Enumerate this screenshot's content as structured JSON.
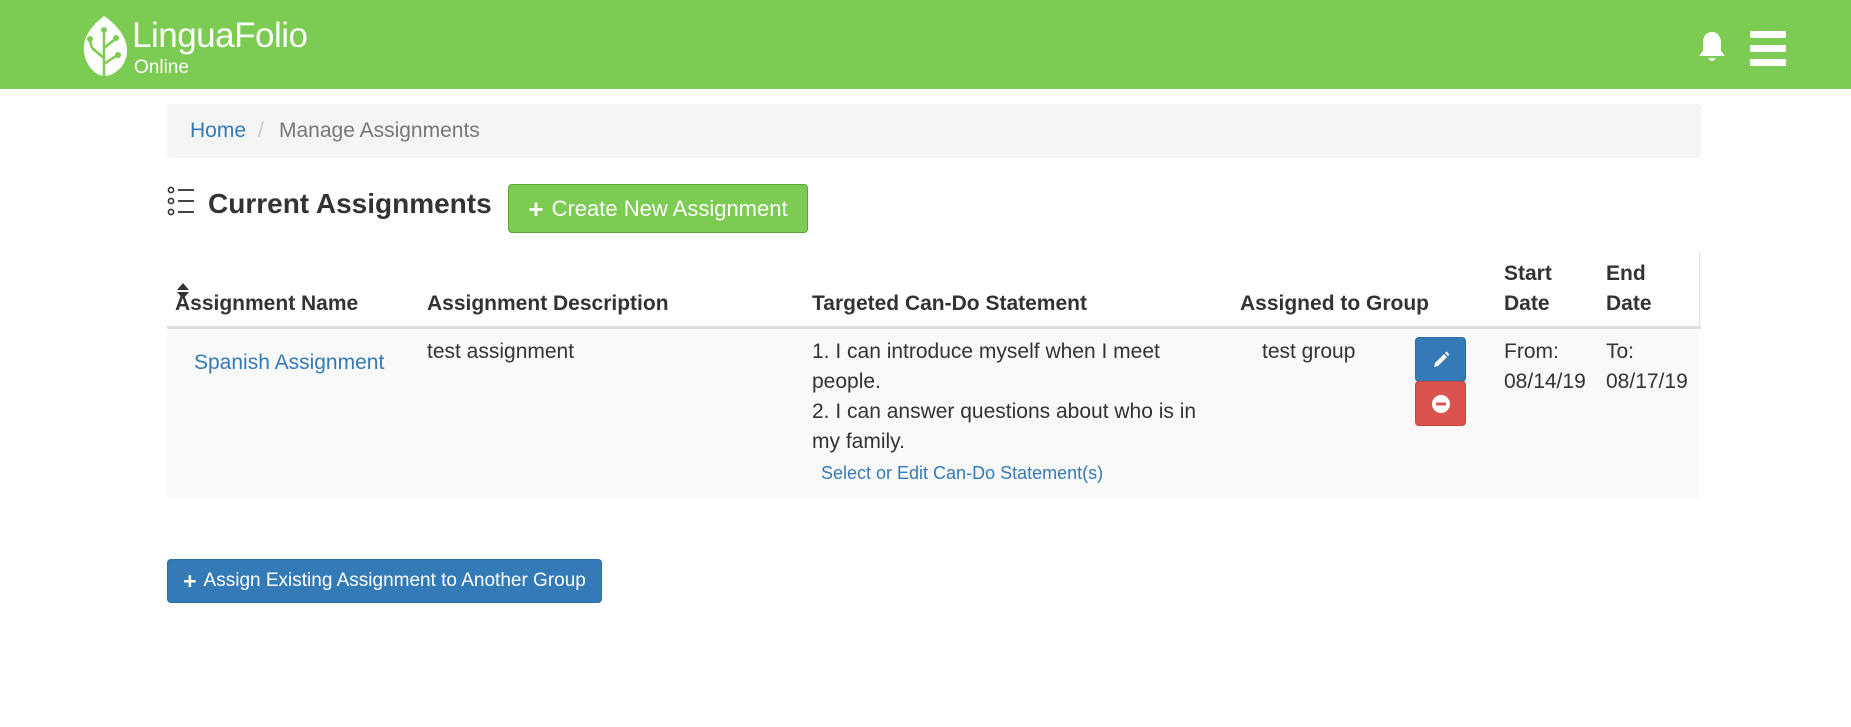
{
  "header": {
    "brand_name": "LinguaFolio",
    "brand_sub": "Online",
    "accent_color": "#7ccb52",
    "icons": [
      "leaf-logo",
      "bell-icon",
      "hamburger-menu-icon"
    ]
  },
  "breadcrumb": {
    "home": "Home",
    "separator": "/",
    "current": "Manage Assignments"
  },
  "main": {
    "title": "Current Assignments",
    "create_button": "Create New Assignment",
    "assign_button": "Assign Existing Assignment to Another Group"
  },
  "table": {
    "headers": {
      "name": "Assignment Name",
      "description": "Assignment Description",
      "cando": "Targeted Can-Do Statement",
      "group": "Assigned to Group",
      "start_1": "Start",
      "start_2": "Date",
      "end_1": "End",
      "end_2": "Date"
    },
    "rows": [
      {
        "name": "Spanish Assignment",
        "description": "test assignment",
        "cando_1a": "1. I can introduce myself when I meet",
        "cando_1b": "people.",
        "cando_2a": "2. I can answer questions about who is in",
        "cando_2b": "my family.",
        "cando_link": "Select or Edit Can-Do Statement(s)",
        "group": "test group",
        "start_label": "From:",
        "start_date": "08/14/19",
        "end_label": "To:",
        "end_date": "08/17/19"
      }
    ]
  },
  "colors": {
    "primary": "#337ab7",
    "danger": "#d9534f",
    "success": "#7ccb52"
  }
}
